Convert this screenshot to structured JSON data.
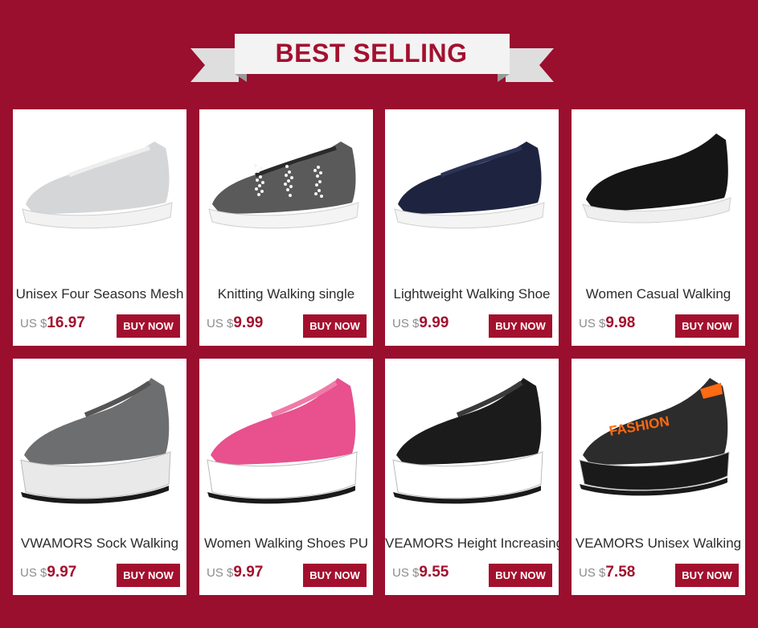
{
  "banner": {
    "title": "BEST SELLING"
  },
  "buy_label": "BUY NOW",
  "currency": "US $",
  "colors": {
    "background": "#9a0e2e",
    "accent": "#a3102e",
    "card": "#ffffff"
  },
  "products": [
    {
      "title": "Unisex Four Seasons Mesh",
      "price": "16.97",
      "shoe": {
        "upper": "#d4d6d8",
        "accent": "#eeeeee",
        "sole": "#f2f2f2",
        "style": "slip"
      }
    },
    {
      "title": "Knitting Walking single",
      "price": "9.99",
      "shoe": {
        "upper": "#5a5a5a",
        "accent": "#2a2a2a",
        "sole": "#f4f4f4",
        "style": "sparkle"
      }
    },
    {
      "title": "Lightweight Walking Shoe",
      "price": "9.99",
      "shoe": {
        "upper": "#1e2440",
        "accent": "#2c3356",
        "sole": "#f4f4f4",
        "style": "slip"
      }
    },
    {
      "title": "Women Casual Walking",
      "price": "9.98",
      "shoe": {
        "upper": "#151515",
        "accent": "#222222",
        "sole": "#efefef",
        "style": "sock"
      }
    },
    {
      "title": "VWAMORS Sock Walking",
      "price": "9.97",
      "shoe": {
        "upper": "#6d6e70",
        "accent": "#555555",
        "sole": "#e9e9e9",
        "style": "air"
      }
    },
    {
      "title": "Women Walking Shoes PU",
      "price": "9.97",
      "shoe": {
        "upper": "#e8508e",
        "accent": "#f07aa8",
        "sole": "#ffffff",
        "style": "platform"
      }
    },
    {
      "title": "VEAMORS Height Increasing",
      "price": "9.55",
      "shoe": {
        "upper": "#1b1b1b",
        "accent": "#3a3a3a",
        "sole": "#ffffff",
        "style": "platform"
      }
    },
    {
      "title": "VEAMORS Unisex Walking",
      "price": "7.58",
      "shoe": {
        "upper": "#2c2c2c",
        "accent": "#ff6a13",
        "sole": "#1a1a1a",
        "style": "fashion",
        "print": "FASHION"
      }
    }
  ]
}
